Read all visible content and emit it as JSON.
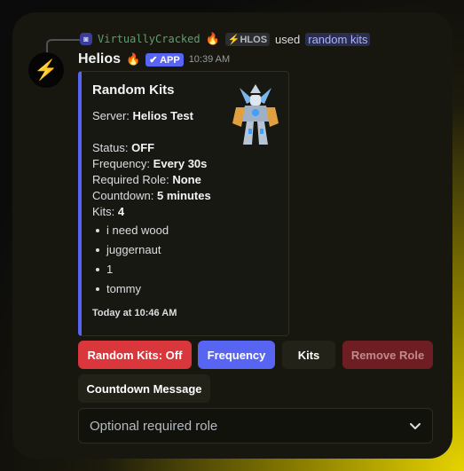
{
  "reply": {
    "user_name": "VirtuallyCracked",
    "guild_tag": "⚡HLOS",
    "used_text": "used",
    "command": "random kits",
    "avatar_glyph": "◙"
  },
  "message": {
    "bot_name": "Helios",
    "app_label": "✔ APP",
    "timestamp": "10:39 AM",
    "avatar_glyph": "⚡",
    "flame_glyph": "🔥"
  },
  "embed": {
    "accent_color": "#5865f2",
    "title": "Random Kits",
    "server_label": "Server:",
    "server_value": "Helios Test",
    "status_label": "Status:",
    "status_value": "OFF",
    "frequency_label": "Frequency:",
    "frequency_value": "Every 30s",
    "role_label": "Required Role:",
    "role_value": "None",
    "countdown_label": "Countdown:",
    "countdown_value": "5 minutes",
    "kits_label": "Kits:",
    "kits_value": "4",
    "kits": [
      "i need wood",
      "juggernaut",
      "1",
      "tommy"
    ],
    "footer": "Today at 10:46 AM",
    "thumbnail_icon": "robot-figure-thumbnail"
  },
  "buttons": {
    "random_kits": "Random Kits: Off",
    "frequency": "Frequency",
    "kits": "Kits",
    "remove_role": "Remove Role",
    "countdown_message": "Countdown Message"
  },
  "select": {
    "placeholder": "Optional required role"
  },
  "colors": {
    "danger": "#da373c",
    "blurple": "#5865f2",
    "disabled_danger": "#6e1e22"
  }
}
